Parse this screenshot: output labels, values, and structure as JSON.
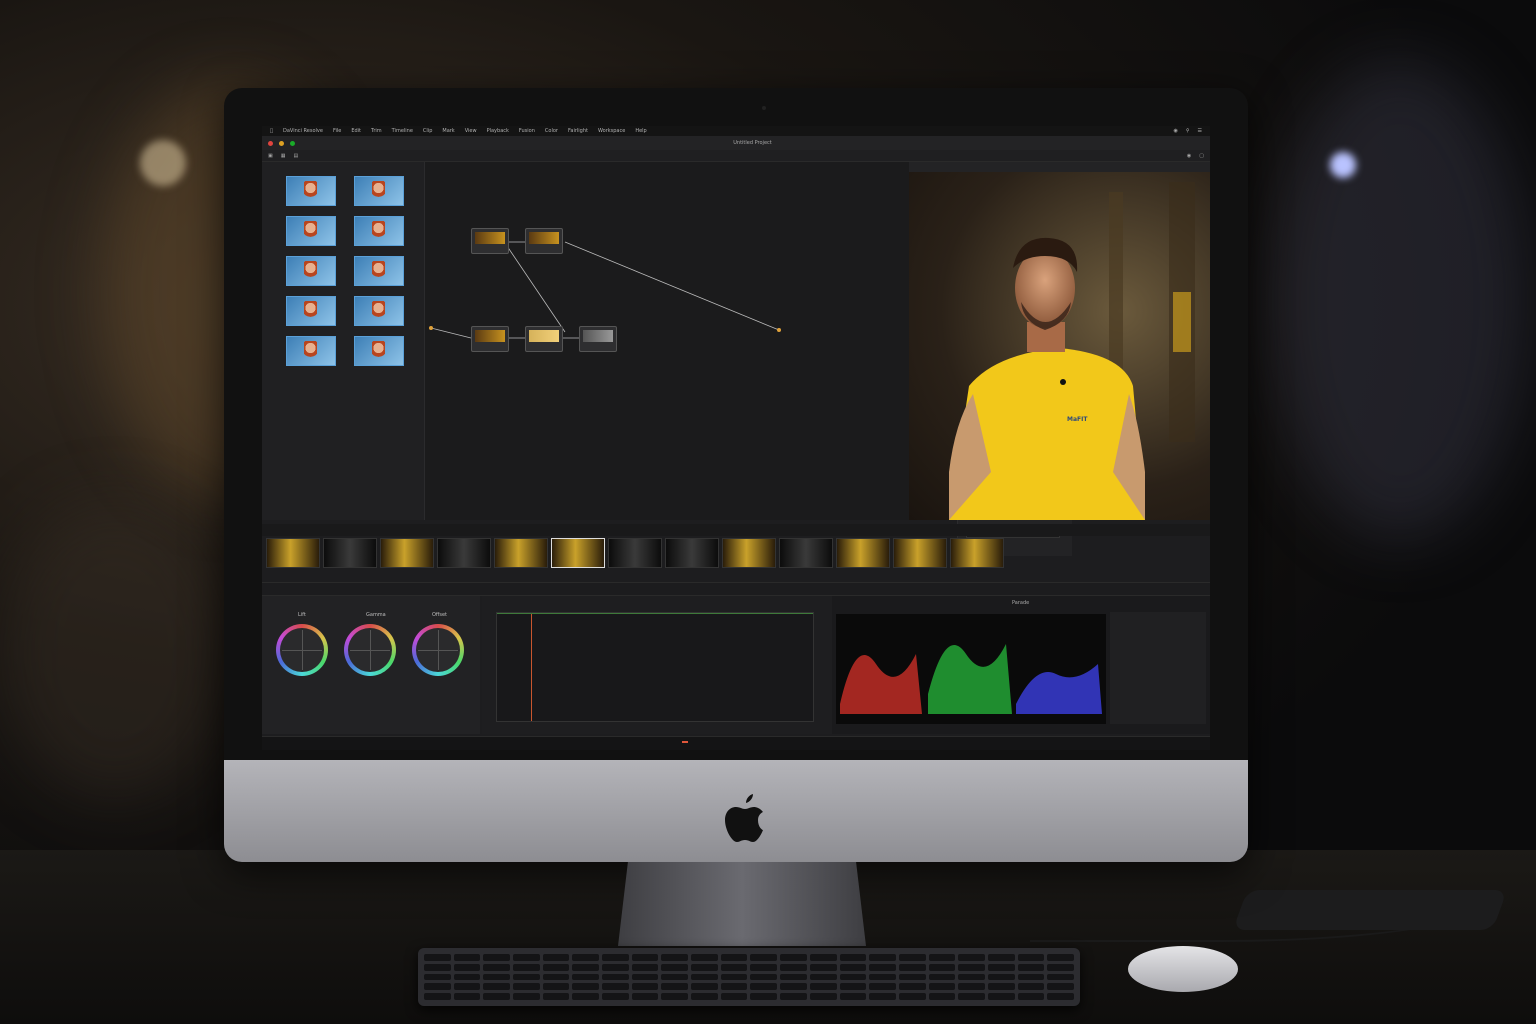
{
  "app": {
    "menu": [
      "DaVinci Resolve",
      "File",
      "Edit",
      "Trim",
      "Timeline",
      "Clip",
      "Mark",
      "View",
      "Playback",
      "Fusion",
      "Color",
      "Fairlight",
      "Workspace",
      "Help"
    ],
    "project_name": "Untitled Project"
  },
  "viewer": {
    "shirt_logo_text": "MaFIT"
  },
  "colors": {
    "accent": "#e0573b",
    "timecode_blue": "#5aa0d8",
    "shirt_yellow": "#f2c81a"
  },
  "scopes": {
    "type": "Parade"
  },
  "wheels": {
    "labels": [
      "Lift",
      "Gamma",
      "Offset"
    ]
  }
}
